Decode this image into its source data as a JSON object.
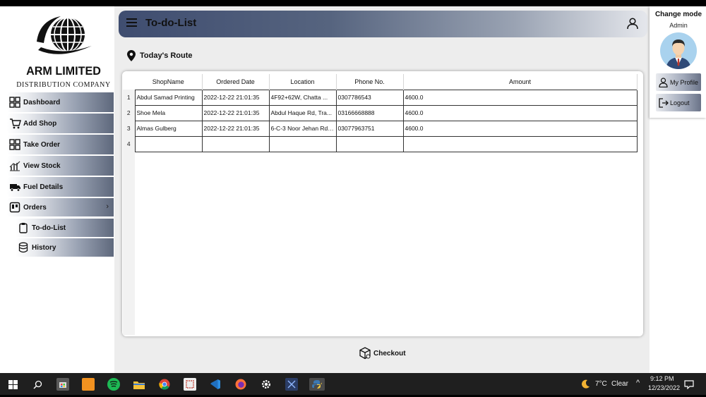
{
  "brand": {
    "name": "ARM LIMITED",
    "subtitle": "DISTRIBUTION COMPANY"
  },
  "sidebar": {
    "items": [
      {
        "label": "Dashboard",
        "icon": "dashboard-grid-icon"
      },
      {
        "label": "Add Shop",
        "icon": "cart-icon"
      },
      {
        "label": "Take Order",
        "icon": "grid-icon"
      },
      {
        "label": "View Stock",
        "icon": "stock-chart-icon"
      },
      {
        "label": "Fuel Details",
        "icon": "truck-icon"
      },
      {
        "label": "Orders",
        "icon": "orders-icon"
      }
    ],
    "subitems": [
      {
        "label": "To-do-List",
        "icon": "clipboard-icon"
      },
      {
        "label": "History",
        "icon": "database-icon"
      }
    ]
  },
  "header": {
    "title": "To-do-List"
  },
  "route": {
    "label": "Today's Route"
  },
  "table": {
    "columns": [
      "ShopName",
      "Ordered Date",
      "Location",
      "Phone No.",
      "Amount"
    ],
    "rows": [
      {
        "n": "1",
        "cells": [
          "Abdul Samad Printing",
          "2022-12-22 21:01:35",
          "4F92+62W, Chatta ...",
          "0307786543",
          "4600.0"
        ]
      },
      {
        "n": "2",
        "cells": [
          "Shoe Mela",
          "2022-12-22 21:01:35",
          "Abdul Haque Rd, Tra...",
          "03166668888",
          "4600.0"
        ]
      },
      {
        "n": "3",
        "cells": [
          "Almas Gulberg",
          "2022-12-22 21:01:35",
          "6-C-3 Noor Jehan Rd,...",
          "03077963751",
          "4600.0"
        ]
      },
      {
        "n": "4",
        "cells": [
          "",
          "",
          "",
          "",
          ""
        ]
      }
    ]
  },
  "checkout": {
    "label": "Checkout"
  },
  "right_panel": {
    "mode_label": "Change mode",
    "role": "Admin",
    "profile_label": "My Profile",
    "logout_label": "Logout"
  },
  "taskbar": {
    "weather_temp": "7°C",
    "weather_text": "Clear",
    "time": "9:12 PM",
    "date": "12/23/2022"
  },
  "colors": {
    "accent": "#56647f",
    "panel": "#ededed"
  }
}
